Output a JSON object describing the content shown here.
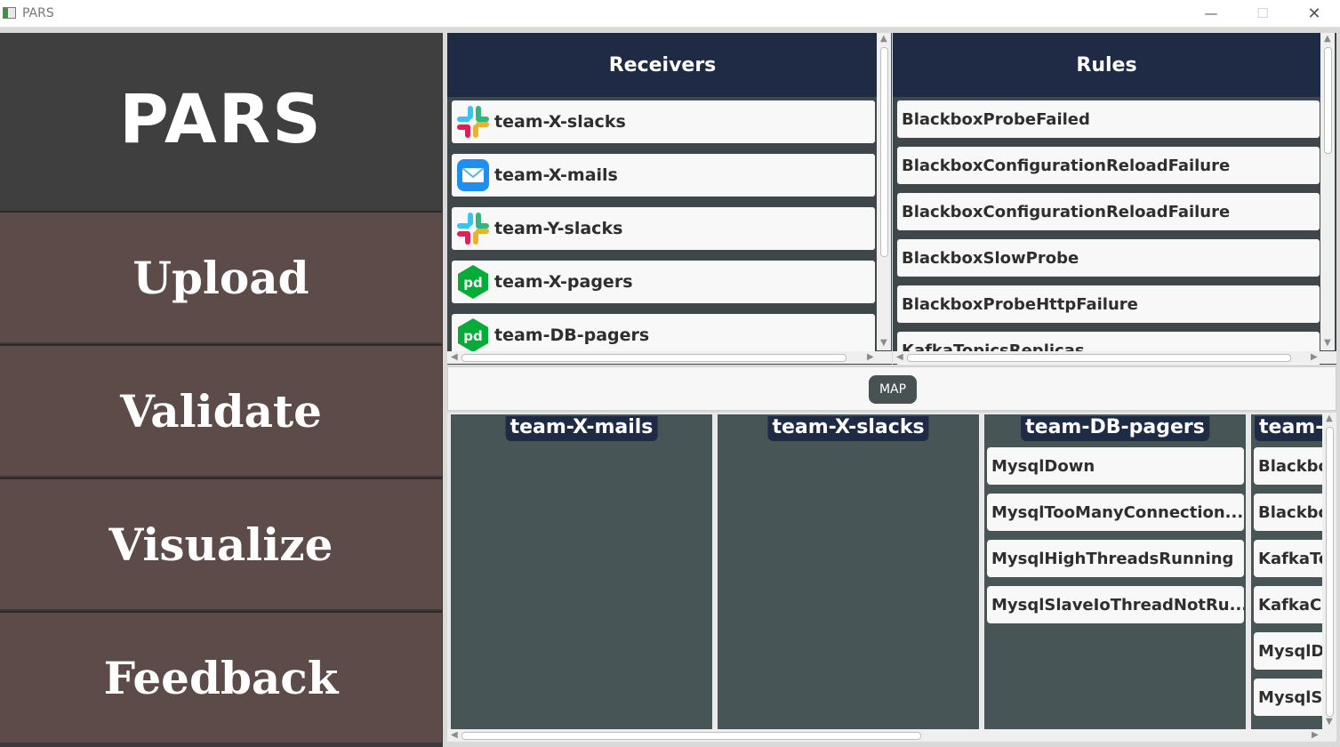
{
  "window": {
    "title": "PARS",
    "minimize": "—",
    "maximize": "☐",
    "close": "✕"
  },
  "sidebar": {
    "logo": "PARS",
    "items": [
      {
        "label": "Upload"
      },
      {
        "label": "Validate"
      },
      {
        "label": "Visualize"
      },
      {
        "label": "Feedback"
      }
    ]
  },
  "receivers": {
    "header": "Receivers",
    "items": [
      {
        "label": "team-X-slacks",
        "icon": "slack-icon"
      },
      {
        "label": "team-X-mails",
        "icon": "mail-icon"
      },
      {
        "label": "team-Y-slacks",
        "icon": "slack-icon"
      },
      {
        "label": "team-X-pagers",
        "icon": "pagerduty-icon"
      },
      {
        "label": "team-DB-pagers",
        "icon": "pagerduty-icon"
      }
    ]
  },
  "rules": {
    "header": "Rules",
    "items": [
      "BlackboxProbeFailed",
      "BlackboxConfigurationReloadFailure",
      "BlackboxConfigurationReloadFailure",
      "BlackboxSlowProbe",
      "BlackboxProbeHttpFailure",
      "KafkaTopicsReplicas"
    ]
  },
  "map_button": "MAP",
  "columns": [
    {
      "title": "team-X-mails",
      "alerts": []
    },
    {
      "title": "team-X-slacks",
      "alerts": []
    },
    {
      "title": "team-DB-pagers",
      "alerts": [
        "MysqlDown",
        "MysqlTooManyConnection...",
        "MysqlHighThreadsRunning",
        "MysqlSlaveIoThreadNotRu..."
      ]
    },
    {
      "title": "team-",
      "alerts": [
        "Blackbo",
        "Blackbo",
        "KafkaTo",
        "KafkaCo",
        "MysqlD",
        "MysqlS"
      ]
    }
  ],
  "colors": {
    "header_navy": "#1f2a45",
    "sidebar_nav": "#5d4b49",
    "logo_bg": "#3f3f3f",
    "column_bg": "#485556",
    "map_button": "#485252"
  }
}
